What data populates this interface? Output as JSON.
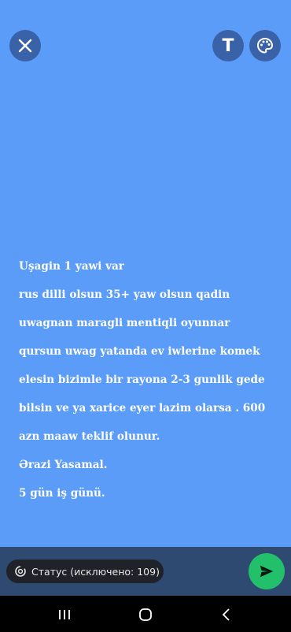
{
  "status_text": {
    "lines": [
      "Uşagin 1 yawi var",
      "rus dilli olsun 35+ yaw olsun qadin",
      "uwagnan maragli mentiqli oyunnar",
      "qursun uwag yatanda ev iwlerine komek",
      "elesin bizimle bir rayona 2-3 gunlik gede",
      "bilsin ve ya xarice eyer lazim olarsa . 600",
      "azn maaw teklif olunur.",
      "Ərazi  Yasamal.",
      "5 gün iş günü."
    ]
  },
  "toolbar": {
    "text_label": "T"
  },
  "privacy_chip": {
    "label": "Статус (исключено: 109)"
  },
  "icons": {
    "close": "close-icon",
    "text": "text-icon",
    "palette": "palette-icon",
    "privacy": "privacy-icon",
    "send": "send-icon",
    "recents": "recents-icon",
    "home": "home-icon",
    "back": "back-icon"
  },
  "colors": {
    "background": "#5b9cf8",
    "button_bg": "#3a62a8",
    "bottom_bar": "#2f4a70",
    "chip_bg": "#1f2229",
    "send": "#23c06b",
    "nav_bar": "#000000"
  }
}
